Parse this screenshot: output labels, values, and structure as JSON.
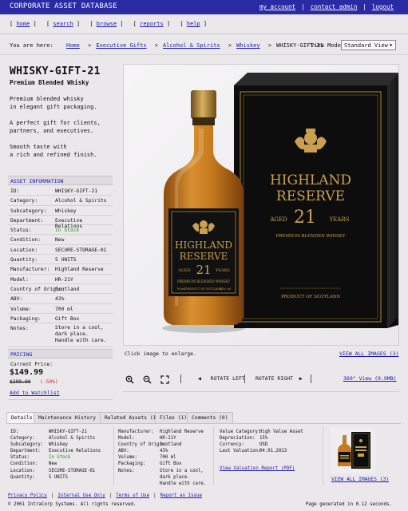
{
  "app": {
    "title": "CORPORATE ASSET DATABASE",
    "user_links": [
      "my_account",
      "contact_admin",
      "logout"
    ],
    "separator": "|"
  },
  "nav": {
    "items": [
      "home",
      "search",
      "browse",
      "reports",
      "help"
    ]
  },
  "breadcrumb": {
    "prefix": "You are here:",
    "items": [
      "Home",
      "Executive Gifts",
      "Alcohol & Spirits",
      "Whiskey"
    ],
    "current": "WHISKY-GIFT-21",
    "sep": ">"
  },
  "view_mode": {
    "label": "View Mode:",
    "value": "Standard View"
  },
  "asset": {
    "title": "WHISKY-GIFT-21",
    "subtitle": "Premium Blended Whisky",
    "desc": [
      [
        "Premium blended whisky",
        "in elegant gift packaging."
      ],
      [
        "A perfect gift for clients,",
        "partners, and executives."
      ],
      [
        "Smooth taste with",
        "a rich and refined finish."
      ]
    ]
  },
  "asset_info": {
    "header": "ASSET INFORMATION",
    "rows": [
      {
        "k": "ID:",
        "v": "WHISKY-GIFT-21"
      },
      {
        "k": "Category:",
        "v": "Alcohol & Spirits"
      },
      {
        "k": "Subcategory:",
        "v": "Whiskey"
      },
      {
        "k": "Department:",
        "v": "Executive Relations"
      },
      {
        "k": "Status:",
        "v": "In Stock"
      },
      {
        "k": "Condition:",
        "v": "New"
      },
      {
        "k": "Location:",
        "v": "SECURE-STORAGE-01"
      },
      {
        "k": "Quantity:",
        "v": "5 UNITS"
      },
      {
        "k": "Manufacturer:",
        "v": "Highland Reserve"
      },
      {
        "k": "Model:",
        "v": "HR-21Y"
      },
      {
        "k": "Country of Origin:",
        "v": "Scotland"
      },
      {
        "k": "ABV:",
        "v": "43%"
      },
      {
        "k": "Volume:",
        "v": "700 ml"
      },
      {
        "k": "Packaging:",
        "v": "Gift Box"
      },
      {
        "k": "Notes:",
        "v": [
          "Store in a cool,",
          "dark place.",
          "Handle with care."
        ]
      }
    ],
    "status_color": "#208a20"
  },
  "pricing": {
    "header": "PRICING",
    "current_label": "Current Price:",
    "current": "$149.99",
    "original": "$299.00",
    "discount": "(-50%)",
    "watchlist": "Add to Watchlist",
    "discount_color": "#d21f1f"
  },
  "product_image": {
    "box_brand": [
      "HIGHLAND",
      "RESERVE"
    ],
    "box_aged": [
      "AGED",
      "21",
      "YEARS"
    ],
    "box_type": "PREMIUM BLENDED WHISKY",
    "box_origin": "PRODUCT OF SCOTLAND",
    "bottle_brand": [
      "HIGHLAND",
      "RESERVE"
    ],
    "bottle_aged": [
      "AGED",
      "21",
      "YEARS"
    ],
    "bottle_type": "PREMIUM BLENDED WHISKY",
    "bottle_origin": "PRODUCT OF SCOTLAND",
    "bottle_vol": "700ml",
    "bottle_abv": "43% vol"
  },
  "viewer": {
    "hint": "Click image to enlarge.",
    "view_all": "VIEW ALL IMAGES (3)",
    "zoom_in_icon": "zoom-in-icon",
    "zoom_out_icon": "zoom-out-icon",
    "fullscreen_icon": "fullscreen-icon",
    "rotate_left": "ROTATE LEFT",
    "rotate_right": "ROTATE RIGHT",
    "view_360": "360° View (0.9MB)"
  },
  "tabs": [
    "Details",
    "Maintenance History (0)",
    "Related Assets (1)",
    "Files (1)",
    "Comments (0)"
  ],
  "details": {
    "col1": [
      {
        "k": "ID:",
        "v": "WHISKY-GIFT-21"
      },
      {
        "k": "Category:",
        "v": "Alcohol & Spirits"
      },
      {
        "k": "Subcategory:",
        "v": "Whiskey"
      },
      {
        "k": "Department:",
        "v": "Executive Relations"
      },
      {
        "k": "Status:",
        "v": "In Stock"
      },
      {
        "k": "Condition:",
        "v": "New"
      },
      {
        "k": "Location:",
        "v": "SECURE-STORAGE-01"
      },
      {
        "k": "Quantity:",
        "v": "5 UNITS"
      }
    ],
    "col2": [
      {
        "k": "Manufacturer:",
        "v": "Highland Reserve"
      },
      {
        "k": "Model:",
        "v": "HR-21Y"
      },
      {
        "k": "Country of Origin:",
        "v": "Scotland"
      },
      {
        "k": "ABV:",
        "v": "43%"
      },
      {
        "k": "Volume:",
        "v": "700 ml"
      },
      {
        "k": "Packaging:",
        "v": "Gift Box"
      },
      {
        "k": "Notes:",
        "v": "Store in a cool,"
      },
      {
        "k": "",
        "v": "dark place."
      },
      {
        "k": "",
        "v": "Handle with care."
      }
    ],
    "col3": [
      {
        "k": "Value Category:",
        "v": "High Value Asset"
      },
      {
        "k": "Depreciation:",
        "v": "15%"
      },
      {
        "k": "Currency:",
        "v": "USD"
      },
      {
        "k": "Last Valuation:",
        "v": "04.01.2023"
      }
    ],
    "valuation_link": "View Valuation Report (PDF)",
    "view_all": "VIEW ALL IMAGES (3)"
  },
  "footer": {
    "links": [
      "Privacy Policy",
      "Internal Use Only",
      "Terms of Use",
      "Report an Issue"
    ],
    "copyright": "© 2001 IntraCorp Systems. All rights reserved.",
    "generated": "Page generated in 0.12 seconds."
  }
}
